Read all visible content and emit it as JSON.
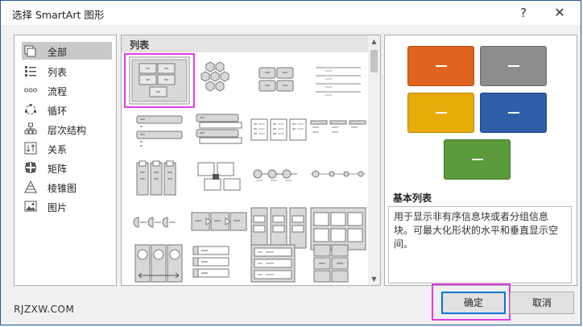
{
  "window": {
    "title": "选择 SmartArt 图形",
    "help_glyph": "?",
    "close_glyph": "✕"
  },
  "categories": [
    {
      "label": "全部",
      "icon": "all-icon",
      "selected": true
    },
    {
      "label": "列表",
      "icon": "list-icon"
    },
    {
      "label": "流程",
      "icon": "process-icon"
    },
    {
      "label": "循环",
      "icon": "cycle-icon"
    },
    {
      "label": "层次结构",
      "icon": "hierarchy-icon"
    },
    {
      "label": "关系",
      "icon": "relationship-icon"
    },
    {
      "label": "矩阵",
      "icon": "matrix-icon"
    },
    {
      "label": "棱锥图",
      "icon": "pyramid-icon"
    },
    {
      "label": "图片",
      "icon": "picture-icon"
    }
  ],
  "gallery": {
    "header": "列表",
    "selected_index": 0,
    "scroll_up": "▲",
    "scroll_down": "▼"
  },
  "preview": {
    "title": "基本列表",
    "description": "用于显示非有序信息块或者分组信息块。可最大化形状的水平和垂直显示空间。",
    "box_colors": [
      "#e0641e",
      "#8c8c8c",
      "#e7ab0a",
      "#2f5ea8",
      "#5a9a3a"
    ]
  },
  "footer": {
    "watermark": "RJZXW.COM",
    "ok_label": "确定",
    "cancel_label": "取消"
  }
}
